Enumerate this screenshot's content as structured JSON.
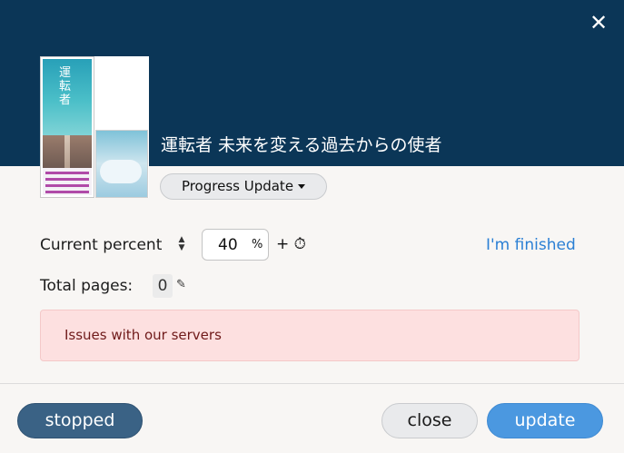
{
  "header": {
    "book_title": "運転者 未来を変える過去からの使者",
    "close_glyph": "✕",
    "cover_title_vertical": "運転者",
    "background_color": "#0b3657"
  },
  "progress_menu": {
    "label": "Progress Update"
  },
  "current_percent": {
    "label": "Current percent",
    "sort_up": "▲",
    "sort_down": "▼",
    "value": "40",
    "unit": "%",
    "add_time_glyph": "+ ⏱",
    "finished_link": "I'm finished"
  },
  "total_pages": {
    "label": "Total pages:",
    "value": "0",
    "edit_glyph": "✎"
  },
  "alert": {
    "message": "Issues with our servers"
  },
  "footer": {
    "stopped_label": "stopped",
    "close_label": "close",
    "update_label": "update"
  }
}
